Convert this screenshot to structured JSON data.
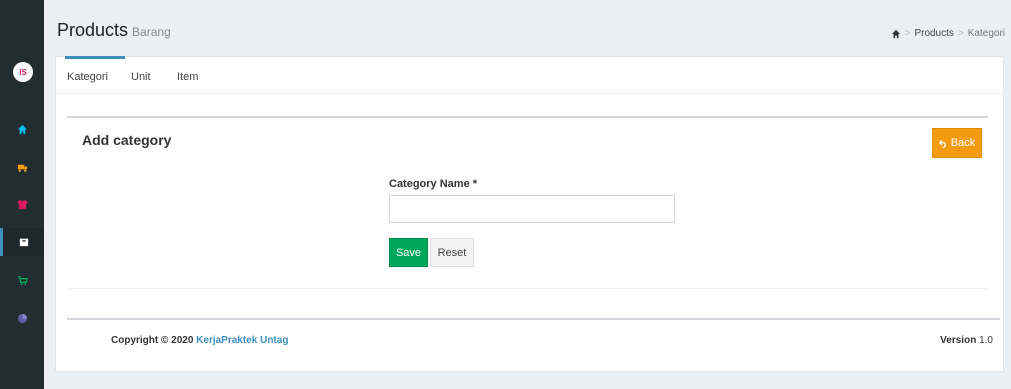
{
  "header": {
    "title": "Products",
    "subtitle": "Barang"
  },
  "breadcrumb": {
    "items": [
      "Products",
      "Kategori"
    ]
  },
  "tabs": [
    {
      "label": "Kategori",
      "active": true
    },
    {
      "label": "Unit",
      "active": false
    },
    {
      "label": "Item",
      "active": false
    }
  ],
  "panel": {
    "title": "Add category",
    "back_label": "Back",
    "field_label": "Category Name *",
    "field_value": "",
    "save_label": "Save",
    "reset_label": "Reset"
  },
  "footer": {
    "copyright": "Copyright © 2020",
    "company": "KerjaPraktek Untag",
    "version_label": "Version",
    "version_value": "1.0"
  },
  "sidebar": {
    "logo_text": "IS",
    "items": [
      {
        "icon": "home-icon",
        "color": "#00c0ef"
      },
      {
        "icon": "truck-icon",
        "color": "#f39c12"
      },
      {
        "icon": "shirt-icon",
        "color": "#d81b60"
      },
      {
        "icon": "box-icon",
        "color": "#ffffff",
        "active": true
      },
      {
        "icon": "cart-icon",
        "color": "#00a65a"
      },
      {
        "icon": "chart-icon",
        "color": "#605ca8"
      }
    ]
  },
  "colors": {
    "primary": "#3c8dbc",
    "warning": "#f39c12",
    "success": "#00a65a",
    "sidebar": "#222d32"
  }
}
